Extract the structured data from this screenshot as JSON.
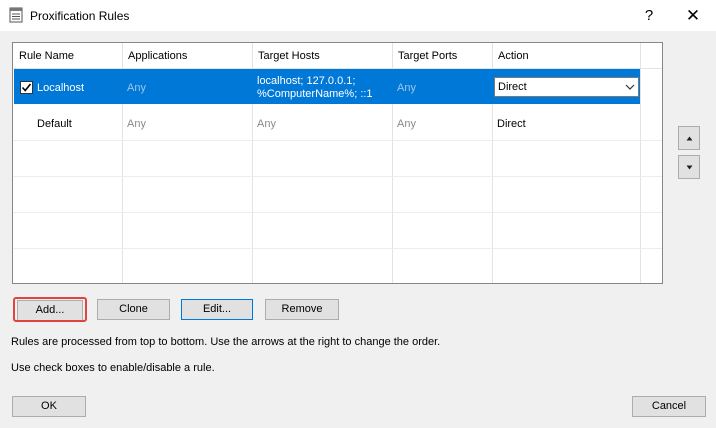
{
  "window": {
    "title": "Proxification Rules",
    "help_label": "?",
    "close_label": "✕"
  },
  "grid": {
    "columns": [
      "Rule Name",
      "Applications",
      "Target Hosts",
      "Target Ports",
      "Action"
    ],
    "rows": [
      {
        "checked": true,
        "selected": true,
        "name": "Localhost",
        "applications": "Any",
        "target_hosts_line1": "localhost; 127.0.0.1;",
        "target_hosts_line2": "%ComputerName%; ::1",
        "target_ports": "Any",
        "action": "Direct"
      },
      {
        "checked": false,
        "selected": false,
        "name": "Default",
        "applications": "Any",
        "target_hosts": "Any",
        "target_ports": "Any",
        "action": "Direct"
      }
    ]
  },
  "buttons": {
    "add": "Add...",
    "clone": "Clone",
    "edit": "Edit...",
    "remove": "Remove",
    "ok": "OK",
    "cancel": "Cancel"
  },
  "info": {
    "line1": "Rules are processed from top to bottom. Use the arrows at the right to change the order.",
    "line2": "Use check boxes to enable/disable a rule."
  },
  "colors": {
    "selection": "#0078d7",
    "highlight": "#e0443e"
  }
}
